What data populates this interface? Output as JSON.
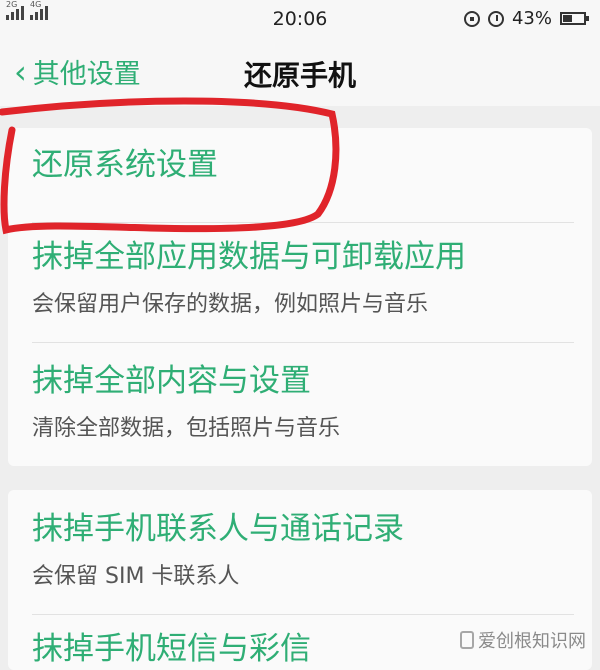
{
  "status_bar": {
    "sim1_label": "2G",
    "sim2_label": "4G",
    "time": "20:06",
    "battery_percent": "43%",
    "battery_level": 0.43
  },
  "header": {
    "back_label": "其他设置",
    "title": "还原手机"
  },
  "group1": [
    {
      "title": "还原系统设置"
    },
    {
      "title": "抹掉全部应用数据与可卸载应用",
      "subtitle": "会保留用户保存的数据，例如照片与音乐"
    },
    {
      "title": "抹掉全部内容与设置",
      "subtitle": "清除全部数据，包括照片与音乐"
    }
  ],
  "group2": [
    {
      "title": "抹掉手机联系人与通话记录",
      "subtitle": "会保留 SIM 卡联系人"
    },
    {
      "title": "抹掉手机短信与彩信"
    }
  ],
  "watermark": "爱创根知识网",
  "colors": {
    "accent": "#2fae75",
    "annotation": "#e0242a"
  }
}
